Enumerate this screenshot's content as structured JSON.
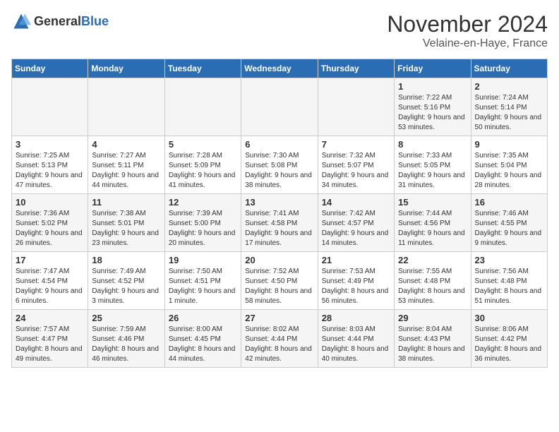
{
  "logo": {
    "text_general": "General",
    "text_blue": "Blue"
  },
  "header": {
    "month_title": "November 2024",
    "location": "Velaine-en-Haye, France"
  },
  "weekdays": [
    "Sunday",
    "Monday",
    "Tuesday",
    "Wednesday",
    "Thursday",
    "Friday",
    "Saturday"
  ],
  "weeks": [
    [
      {
        "day": "",
        "detail": ""
      },
      {
        "day": "",
        "detail": ""
      },
      {
        "day": "",
        "detail": ""
      },
      {
        "day": "",
        "detail": ""
      },
      {
        "day": "",
        "detail": ""
      },
      {
        "day": "1",
        "detail": "Sunrise: 7:22 AM\nSunset: 5:16 PM\nDaylight: 9 hours and 53 minutes."
      },
      {
        "day": "2",
        "detail": "Sunrise: 7:24 AM\nSunset: 5:14 PM\nDaylight: 9 hours and 50 minutes."
      }
    ],
    [
      {
        "day": "3",
        "detail": "Sunrise: 7:25 AM\nSunset: 5:13 PM\nDaylight: 9 hours and 47 minutes."
      },
      {
        "day": "4",
        "detail": "Sunrise: 7:27 AM\nSunset: 5:11 PM\nDaylight: 9 hours and 44 minutes."
      },
      {
        "day": "5",
        "detail": "Sunrise: 7:28 AM\nSunset: 5:09 PM\nDaylight: 9 hours and 41 minutes."
      },
      {
        "day": "6",
        "detail": "Sunrise: 7:30 AM\nSunset: 5:08 PM\nDaylight: 9 hours and 38 minutes."
      },
      {
        "day": "7",
        "detail": "Sunrise: 7:32 AM\nSunset: 5:07 PM\nDaylight: 9 hours and 34 minutes."
      },
      {
        "day": "8",
        "detail": "Sunrise: 7:33 AM\nSunset: 5:05 PM\nDaylight: 9 hours and 31 minutes."
      },
      {
        "day": "9",
        "detail": "Sunrise: 7:35 AM\nSunset: 5:04 PM\nDaylight: 9 hours and 28 minutes."
      }
    ],
    [
      {
        "day": "10",
        "detail": "Sunrise: 7:36 AM\nSunset: 5:02 PM\nDaylight: 9 hours and 26 minutes."
      },
      {
        "day": "11",
        "detail": "Sunrise: 7:38 AM\nSunset: 5:01 PM\nDaylight: 9 hours and 23 minutes."
      },
      {
        "day": "12",
        "detail": "Sunrise: 7:39 AM\nSunset: 5:00 PM\nDaylight: 9 hours and 20 minutes."
      },
      {
        "day": "13",
        "detail": "Sunrise: 7:41 AM\nSunset: 4:58 PM\nDaylight: 9 hours and 17 minutes."
      },
      {
        "day": "14",
        "detail": "Sunrise: 7:42 AM\nSunset: 4:57 PM\nDaylight: 9 hours and 14 minutes."
      },
      {
        "day": "15",
        "detail": "Sunrise: 7:44 AM\nSunset: 4:56 PM\nDaylight: 9 hours and 11 minutes."
      },
      {
        "day": "16",
        "detail": "Sunrise: 7:46 AM\nSunset: 4:55 PM\nDaylight: 9 hours and 9 minutes."
      }
    ],
    [
      {
        "day": "17",
        "detail": "Sunrise: 7:47 AM\nSunset: 4:54 PM\nDaylight: 9 hours and 6 minutes."
      },
      {
        "day": "18",
        "detail": "Sunrise: 7:49 AM\nSunset: 4:52 PM\nDaylight: 9 hours and 3 minutes."
      },
      {
        "day": "19",
        "detail": "Sunrise: 7:50 AM\nSunset: 4:51 PM\nDaylight: 9 hours and 1 minute."
      },
      {
        "day": "20",
        "detail": "Sunrise: 7:52 AM\nSunset: 4:50 PM\nDaylight: 8 hours and 58 minutes."
      },
      {
        "day": "21",
        "detail": "Sunrise: 7:53 AM\nSunset: 4:49 PM\nDaylight: 8 hours and 56 minutes."
      },
      {
        "day": "22",
        "detail": "Sunrise: 7:55 AM\nSunset: 4:48 PM\nDaylight: 8 hours and 53 minutes."
      },
      {
        "day": "23",
        "detail": "Sunrise: 7:56 AM\nSunset: 4:48 PM\nDaylight: 8 hours and 51 minutes."
      }
    ],
    [
      {
        "day": "24",
        "detail": "Sunrise: 7:57 AM\nSunset: 4:47 PM\nDaylight: 8 hours and 49 minutes."
      },
      {
        "day": "25",
        "detail": "Sunrise: 7:59 AM\nSunset: 4:46 PM\nDaylight: 8 hours and 46 minutes."
      },
      {
        "day": "26",
        "detail": "Sunrise: 8:00 AM\nSunset: 4:45 PM\nDaylight: 8 hours and 44 minutes."
      },
      {
        "day": "27",
        "detail": "Sunrise: 8:02 AM\nSunset: 4:44 PM\nDaylight: 8 hours and 42 minutes."
      },
      {
        "day": "28",
        "detail": "Sunrise: 8:03 AM\nSunset: 4:44 PM\nDaylight: 8 hours and 40 minutes."
      },
      {
        "day": "29",
        "detail": "Sunrise: 8:04 AM\nSunset: 4:43 PM\nDaylight: 8 hours and 38 minutes."
      },
      {
        "day": "30",
        "detail": "Sunrise: 8:06 AM\nSunset: 4:42 PM\nDaylight: 8 hours and 36 minutes."
      }
    ]
  ]
}
